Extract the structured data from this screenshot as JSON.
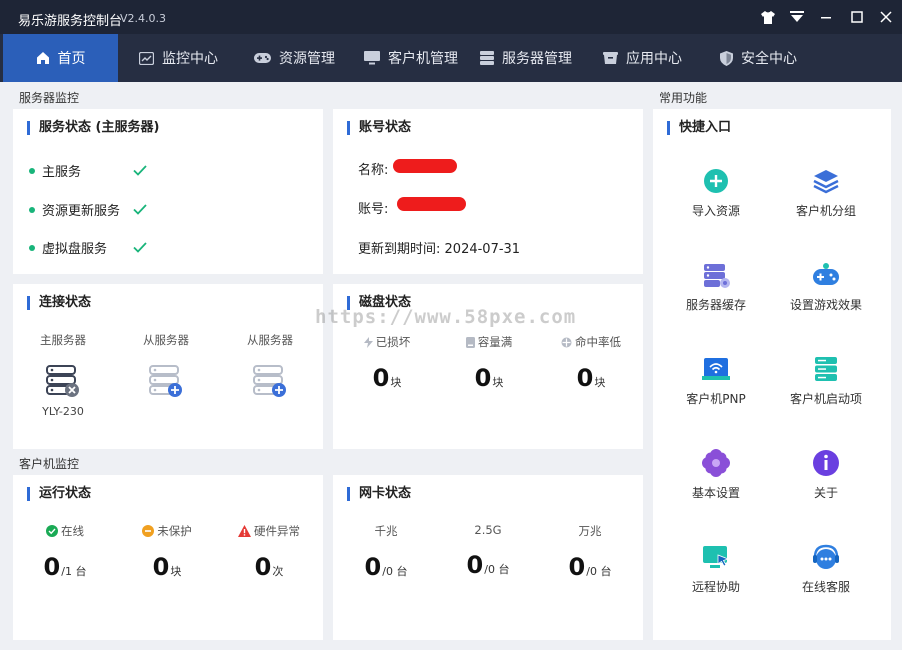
{
  "app": {
    "title": "易乐游服务控制台",
    "version": "V2.4.0.3"
  },
  "nav": [
    {
      "label": "首页",
      "icon": "home-icon"
    },
    {
      "label": "监控中心",
      "icon": "chart-icon"
    },
    {
      "label": "资源管理",
      "icon": "gamepad-icon"
    },
    {
      "label": "客户机管理",
      "icon": "monitor-icon"
    },
    {
      "label": "服务器管理",
      "icon": "server-icon"
    },
    {
      "label": "应用中心",
      "icon": "box-icon"
    },
    {
      "label": "安全中心",
      "icon": "shield-icon"
    }
  ],
  "sections": {
    "server": "服务器监控",
    "client": "客户机监控",
    "common": "常用功能"
  },
  "service": {
    "title": "服务状态 (主服务器)",
    "items": [
      {
        "label": "主服务",
        "status": "ok"
      },
      {
        "label": "资源更新服务",
        "status": "ok"
      },
      {
        "label": "虚拟盘服务",
        "status": "ok"
      }
    ]
  },
  "account": {
    "title": "账号状态",
    "name_label": "名称:",
    "id_label": "账号:",
    "expire_label": "更新到期时间:",
    "expire_value": "2024-07-31"
  },
  "connection": {
    "title": "连接状态",
    "servers": [
      {
        "role": "主服务器",
        "name": "YLY-230",
        "state": "offline"
      },
      {
        "role": "从服务器",
        "name": "",
        "state": "add"
      },
      {
        "role": "从服务器",
        "name": "",
        "state": "add"
      }
    ]
  },
  "disk": {
    "title": "磁盘状态",
    "stats": [
      {
        "label": "已损坏",
        "value": "0",
        "unit": "块"
      },
      {
        "label": "容量满",
        "value": "0",
        "unit": "块"
      },
      {
        "label": "命中率低",
        "value": "0",
        "unit": "块"
      }
    ]
  },
  "run": {
    "title": "运行状态",
    "stats": [
      {
        "label": "在线",
        "value": "0",
        "unit": "/1 台",
        "color": "#1aaa55"
      },
      {
        "label": "未保护",
        "value": "0",
        "unit": "块",
        "color": "#f0a020"
      },
      {
        "label": "硬件异常",
        "value": "0",
        "unit": "次",
        "color": "#e53935"
      }
    ]
  },
  "nic": {
    "title": "网卡状态",
    "stats": [
      {
        "label": "千兆",
        "value": "0",
        "unit": "/0 台"
      },
      {
        "label": "2.5G",
        "value": "0",
        "unit": "/0 台"
      },
      {
        "label": "万兆",
        "value": "0",
        "unit": "/0 台"
      }
    ]
  },
  "quick": {
    "title": "快捷入口",
    "items": [
      {
        "label": "导入资源",
        "icon": "import-resource-icon"
      },
      {
        "label": "客户机分组",
        "icon": "layers-icon"
      },
      {
        "label": "服务器缓存",
        "icon": "server-cache-icon"
      },
      {
        "label": "设置游戏效果",
        "icon": "game-settings-icon"
      },
      {
        "label": "客户机PNP",
        "icon": "pnp-icon"
      },
      {
        "label": "客户机启动项",
        "icon": "startup-icon"
      },
      {
        "label": "基本设置",
        "icon": "flower-settings-icon"
      },
      {
        "label": "关于",
        "icon": "info-icon"
      },
      {
        "label": "远程协助",
        "icon": "remote-assist-icon"
      },
      {
        "label": "在线客服",
        "icon": "chat-support-icon"
      }
    ]
  },
  "watermark": "https://www.58pxe.com",
  "colors": {
    "titlebar": "#1e2536",
    "navbar": "#262e42",
    "nav_active": "#2b5fb9",
    "accent": "#2f6bd6",
    "ok": "#18b47a"
  }
}
